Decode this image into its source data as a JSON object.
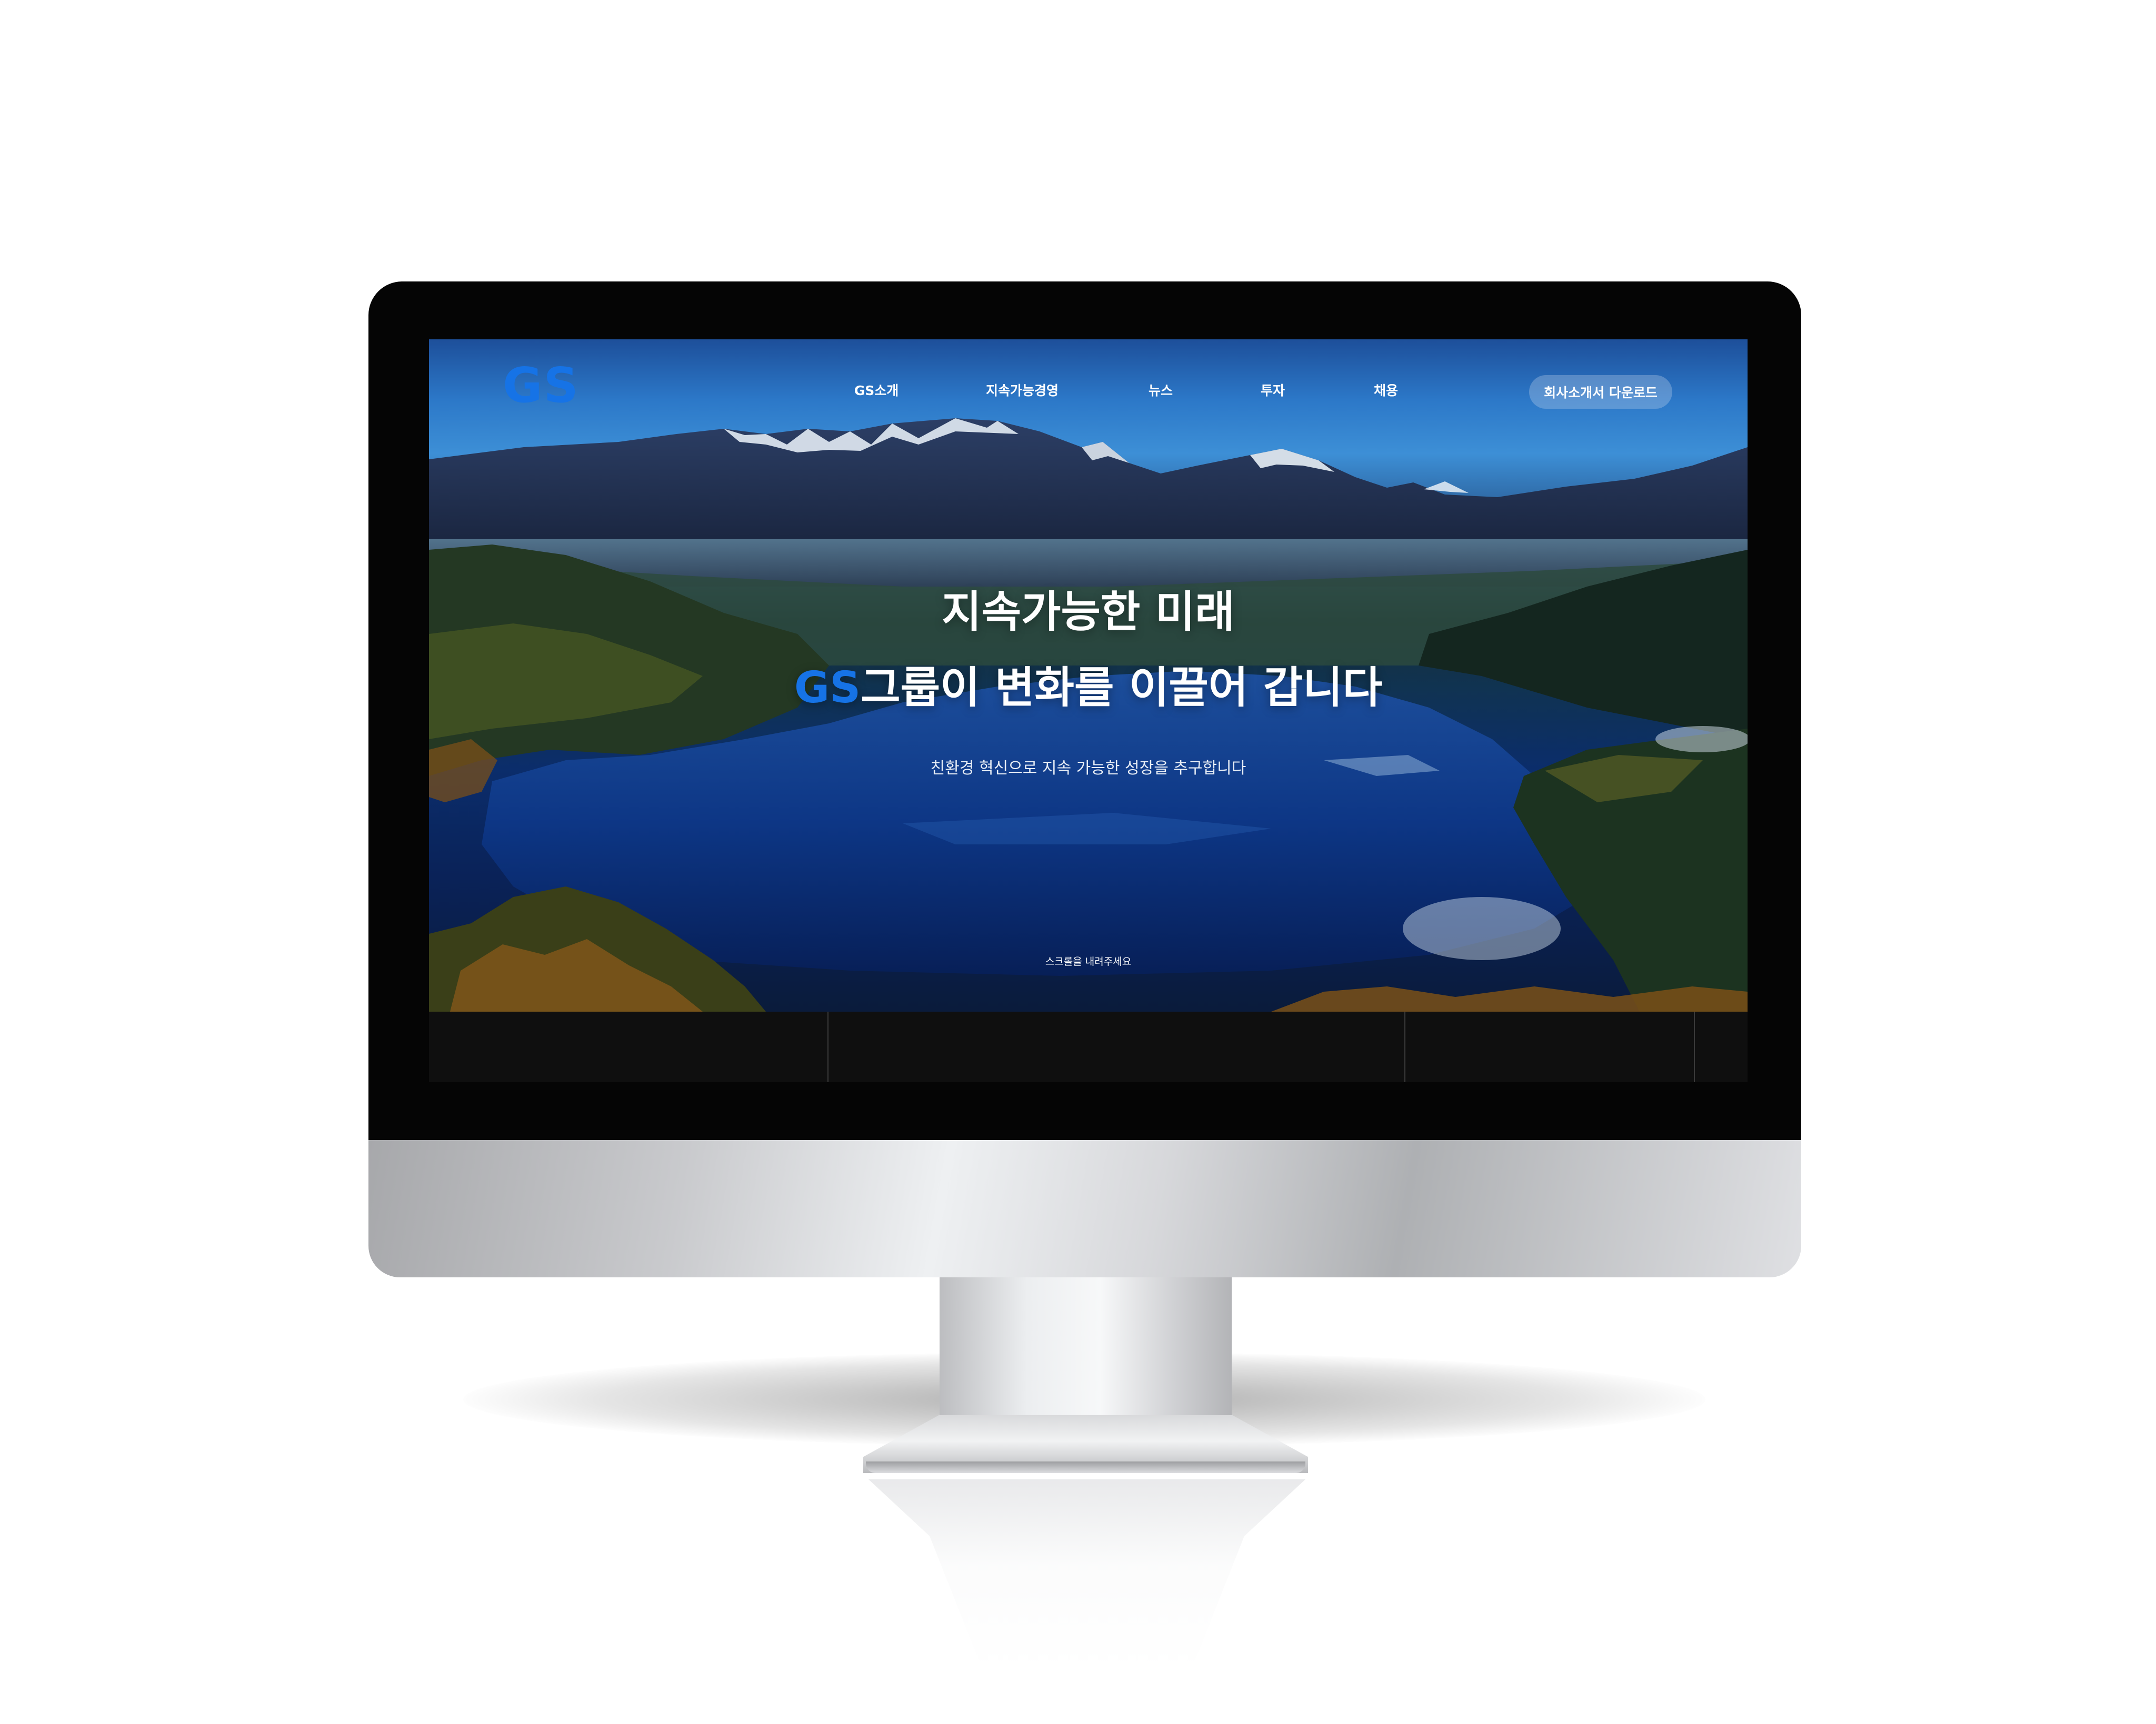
{
  "site": {
    "logo": "GS",
    "nav": [
      "GS소개",
      "지속가능경영",
      "뉴스",
      "투자",
      "채용"
    ],
    "download_button": "회사소개서 다운로드"
  },
  "hero": {
    "line1": "지속가능한 미래",
    "line2_brand": "GS",
    "line2_rest": "그룹이 변화를 이끌어 갑니다",
    "subtitle": "친환경 혁신으로 지속 가능한 성장을 추구합니다",
    "scroll_hint": "스크롤을 내려주세요"
  },
  "colors": {
    "brand_blue": "#1673e6",
    "text": "#ffffff",
    "lower_section": "#0f0f0f",
    "monitor_bezel": "#050505"
  }
}
